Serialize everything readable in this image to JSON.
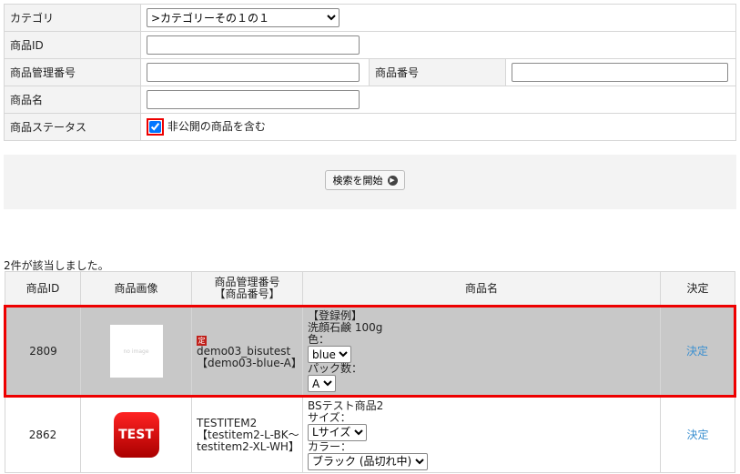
{
  "form": {
    "category_label": "カテゴリ",
    "category_value": ">カテゴリーその１の１",
    "id_label": "商品ID",
    "mgmt_label": "商品管理番号",
    "code_label": "商品番号",
    "name_label": "商品名",
    "status_label": "商品ステータス",
    "status_checkbox_label": "非公開の商品を含む"
  },
  "search_button": "検索を開始",
  "result_count": "2件が該当しました。",
  "table": {
    "headers": [
      "商品ID",
      "商品画像",
      "商品管理番号\n【商品番号】",
      "商品名",
      "決定"
    ],
    "header_mgmt_1": "商品管理番号",
    "header_mgmt_2": "【商品番号】",
    "rows": [
      {
        "id": "2809",
        "image_alt": "no image",
        "badge": "定",
        "mgmt": "demo03_bisutest",
        "code": "【demo03-blue-A】",
        "name1": "【登録例】",
        "name2": "洗顔石鹸 100g",
        "opt1_label": "色：",
        "opt1_value": "blue",
        "opt2_label": "パック数：",
        "opt2_value": "A",
        "action": "決定"
      },
      {
        "id": "2862",
        "image_alt": "TEST",
        "mgmt": "TESTITEM2",
        "code": "【testitem2-L-BK～testitem2-XL-WH】",
        "name1": "BSテスト商品2",
        "opt1_label": "サイズ：",
        "opt1_value": "Lサイズ",
        "opt2_label": "カラー：",
        "opt2_value": "ブラック (品切れ中)",
        "action": "決定"
      }
    ]
  }
}
